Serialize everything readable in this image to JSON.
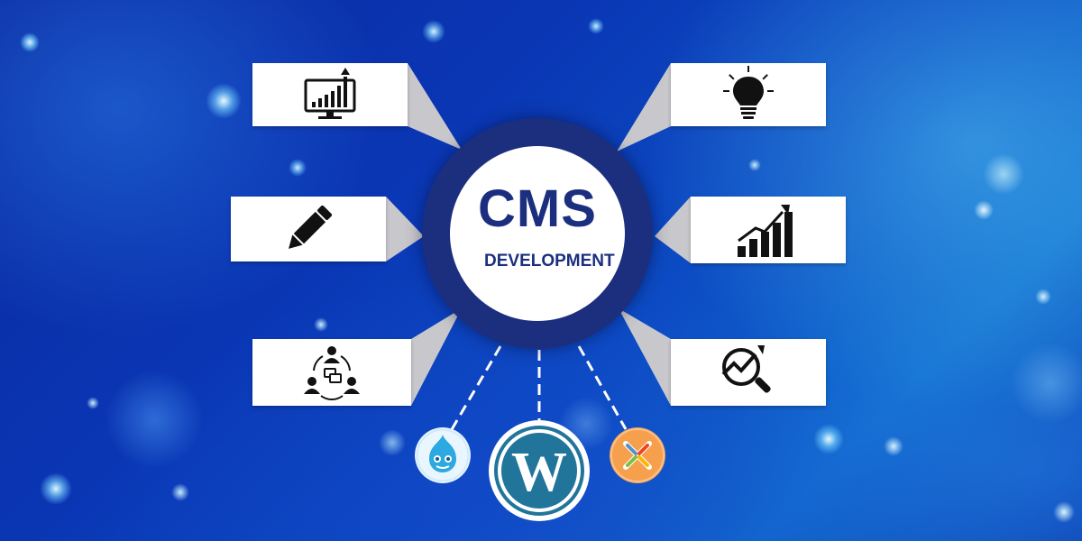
{
  "hub": {
    "title": "CMS",
    "subtitle": "DEVELOPMENT"
  },
  "cards": [
    {
      "side": "left",
      "icon": "monitor-growth-chart-icon"
    },
    {
      "side": "left",
      "icon": "pencil-icon"
    },
    {
      "side": "left",
      "icon": "team-collaboration-icon"
    },
    {
      "side": "right",
      "icon": "lightbulb-icon"
    },
    {
      "side": "right",
      "icon": "rising-bar-chart-icon"
    },
    {
      "side": "right",
      "icon": "analytics-magnifier-icon"
    }
  ],
  "platforms": [
    {
      "icon": "drupal-logo-icon"
    },
    {
      "icon": "wordpress-logo-icon"
    },
    {
      "icon": "joomla-logo-icon"
    }
  ],
  "colors": {
    "hub_ring": "#1b2f7e",
    "text": "#1b2f7e",
    "card": "#ffffff",
    "arm": "#c8c8cc",
    "drupal": "#2ba9e0",
    "wordpress": "#21759b",
    "joomla_bg": "#f6a04d"
  }
}
